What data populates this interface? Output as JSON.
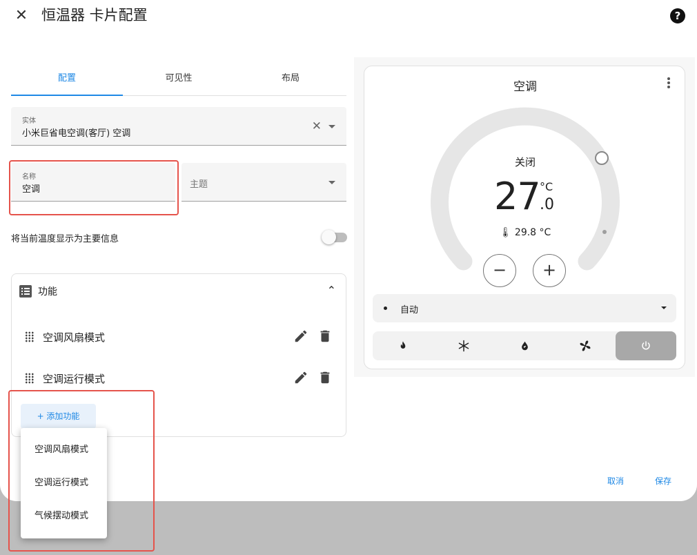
{
  "header": {
    "title": "恒温器 卡片配置",
    "close_glyph": "✕",
    "help_glyph": "?"
  },
  "tabs": [
    {
      "label": "配置",
      "active": true
    },
    {
      "label": "可见性",
      "active": false
    },
    {
      "label": "布局",
      "active": false
    }
  ],
  "entity_field": {
    "label": "实体",
    "value": "小米巨省电空调(客厅) 空调",
    "clear_glyph": "✕"
  },
  "name_field": {
    "label": "名称",
    "value": "空调"
  },
  "theme_field": {
    "placeholder": "主题"
  },
  "primary_info": {
    "label": "将当前温度显示为主要信息",
    "enabled": false
  },
  "features": {
    "title": "功能",
    "expanded": true,
    "chevron_glyph": "⌃",
    "items": [
      {
        "label": "空调风扇模式"
      },
      {
        "label": "空调运行模式"
      }
    ],
    "add_button_label": "+ 添加功能"
  },
  "add_menu": {
    "items": [
      {
        "label": "空调风扇模式"
      },
      {
        "label": "空调运行模式"
      },
      {
        "label": "气候摆动模式"
      }
    ]
  },
  "footer": {
    "cancel_label": "取消",
    "save_label": "保存"
  },
  "preview": {
    "title": "空调",
    "state": "关闭",
    "target_temp_int": "27",
    "target_temp_dec": ".0",
    "unit": "°C",
    "current_temp": "🌡 29.8 °C",
    "minus_glyph": "−",
    "plus_glyph": "+",
    "mode_value": "自动",
    "hvac_modes": [
      {
        "icon": "fire-icon",
        "active": false
      },
      {
        "icon": "snowflake-icon",
        "active": false
      },
      {
        "icon": "water-drop-icon",
        "active": false
      },
      {
        "icon": "fan-icon",
        "active": false
      },
      {
        "icon": "power-icon",
        "active": true
      }
    ]
  },
  "colors": {
    "accent": "#1e88e5",
    "highlight": "#e5534b",
    "dial_track": "#e6e6e6",
    "active_mode": "#a8a8a8"
  }
}
